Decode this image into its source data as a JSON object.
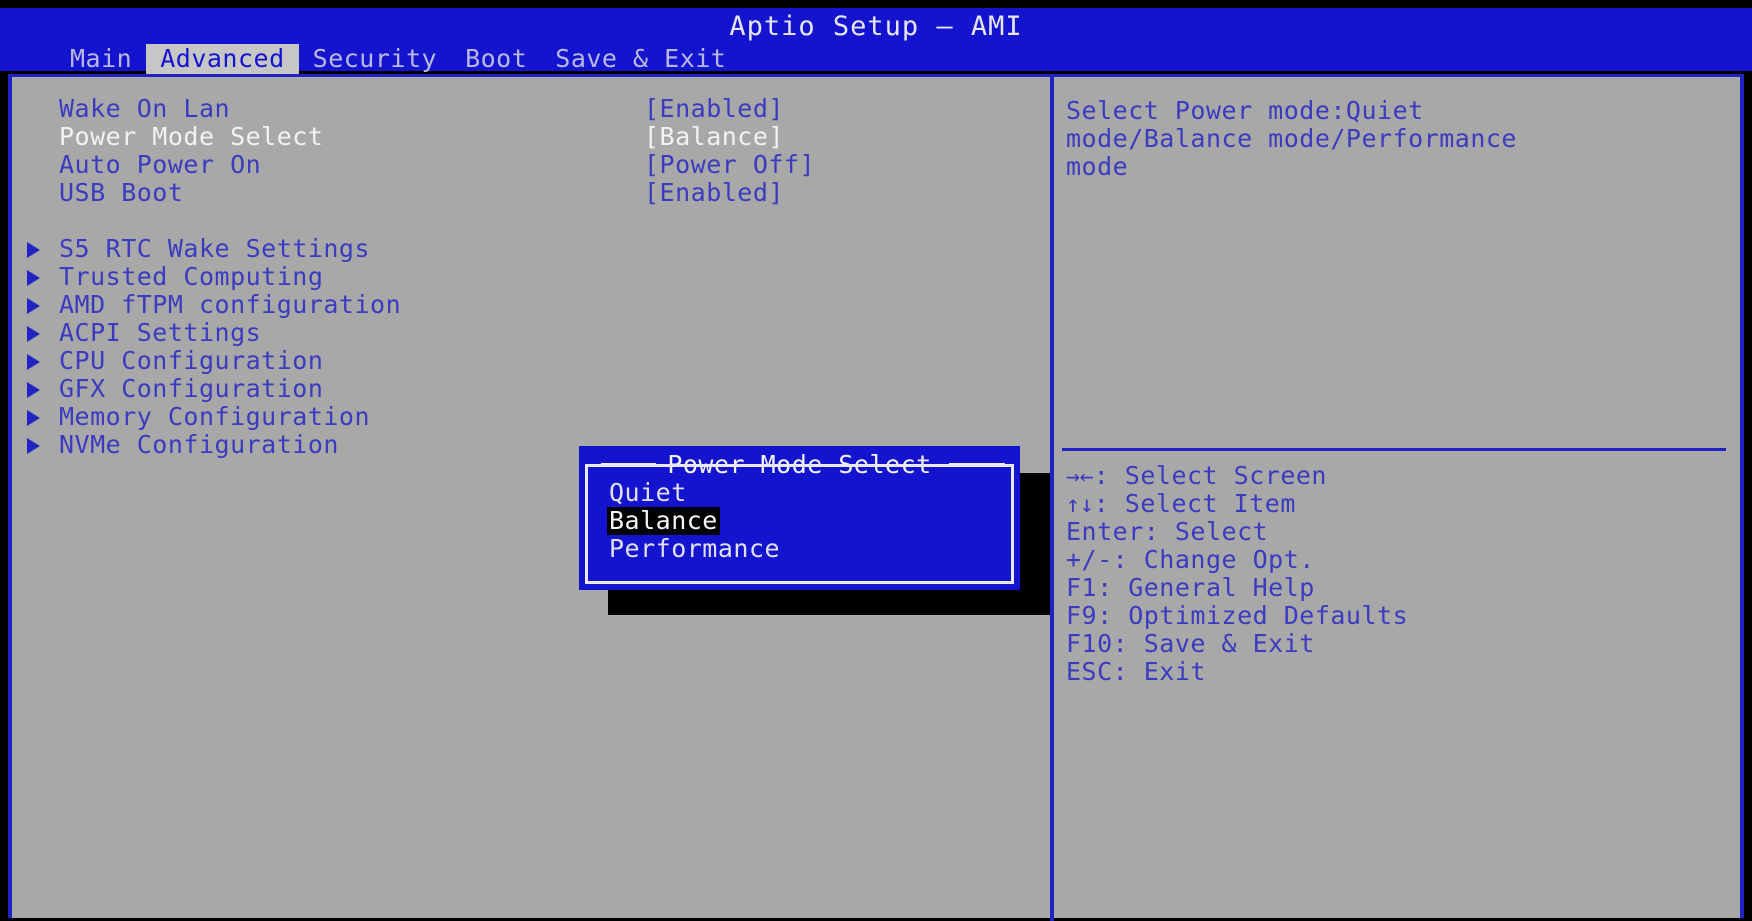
{
  "window": {
    "title": "Aptio Setup – AMI"
  },
  "menubar": {
    "tabs": [
      {
        "label": "Main",
        "active": false
      },
      {
        "label": "Advanced",
        "active": true
      },
      {
        "label": "Security",
        "active": false
      },
      {
        "label": "Boot",
        "active": false
      },
      {
        "label": "Save & Exit",
        "active": false
      }
    ]
  },
  "settings": [
    {
      "label": "Wake On Lan",
      "value": "[Enabled]",
      "selected": false
    },
    {
      "label": "Power Mode Select",
      "value": "[Balance]",
      "selected": true
    },
    {
      "label": "Auto Power On",
      "value": "[Power Off]",
      "selected": false
    },
    {
      "label": "USB Boot",
      "value": "[Enabled]",
      "selected": false
    }
  ],
  "submenus": [
    {
      "label": "S5 RTC Wake Settings"
    },
    {
      "label": "Trusted Computing"
    },
    {
      "label": "AMD fTPM configuration"
    },
    {
      "label": "ACPI Settings"
    },
    {
      "label": "CPU Configuration"
    },
    {
      "label": "GFX Configuration"
    },
    {
      "label": "Memory Configuration"
    },
    {
      "label": "NVMe Configuration"
    }
  ],
  "help": {
    "lines": [
      "Select Power mode:Quiet",
      "mode/Balance mode/Performance",
      "mode"
    ]
  },
  "keylegend": [
    {
      "glyph": "→←",
      "text": ": Select Screen"
    },
    {
      "glyph": "↑↓",
      "text": ": Select Item"
    },
    {
      "glyph": "",
      "text": "Enter: Select"
    },
    {
      "glyph": "",
      "text": "+/-: Change Opt."
    },
    {
      "glyph": "",
      "text": "F1: General Help"
    },
    {
      "glyph": "",
      "text": "F9: Optimized Defaults"
    },
    {
      "glyph": "",
      "text": "F10: Save & Exit"
    },
    {
      "glyph": "",
      "text": "ESC: Exit"
    }
  ],
  "dialog": {
    "title": "Power Mode Select",
    "options": [
      {
        "label": "Quiet",
        "selected": false
      },
      {
        "label": "Balance",
        "selected": true
      },
      {
        "label": "Performance",
        "selected": false
      }
    ]
  },
  "colors": {
    "background": "#a8a8a8",
    "accent_blue": "#1414cf",
    "text_blue": "#3b3bbf",
    "text_white": "#f2f2f2",
    "highlight_black": "#000000"
  }
}
